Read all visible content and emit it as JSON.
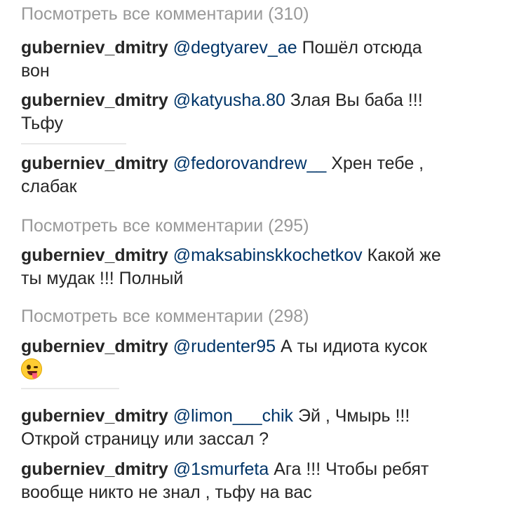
{
  "comments": [
    {
      "type": "view_all",
      "text": "Посмотреть все комментарии (310)"
    },
    {
      "type": "comment",
      "user": "guberniev_dmitry",
      "mention": "@degtyarev_ae",
      "text": "Пошёл отсюда",
      "text2": "вон"
    },
    {
      "type": "comment",
      "user": "guberniev_dmitry",
      "mention": "@katyusha.80",
      "text": "Злая Вы баба !!!",
      "text2": "Тьфу"
    },
    {
      "type": "comment",
      "user": "guberniev_dmitry",
      "mention": "@fedorovandrew__",
      "text": "Хрен тебе ,",
      "text2": "слабак"
    },
    {
      "type": "view_all",
      "text": "Посмотреть все комментарии (295)"
    },
    {
      "type": "comment",
      "user": "guberniev_dmitry",
      "mention": "@maksabinskkochetkov",
      "text": "Какой же",
      "text2": "ты мудак !!! Полный"
    },
    {
      "type": "view_all",
      "text": "Посмотреть все комментарии (298)"
    },
    {
      "type": "comment",
      "user": "guberniev_dmitry",
      "mention": "@rudenter95",
      "text": "А ты идиота кусок",
      "emoji": "zany-face-emoji"
    },
    {
      "type": "comment",
      "user": "guberniev_dmitry",
      "mention": "@limon___chik",
      "text": "Эй , Чмырь !!!",
      "text2": "Открой страницу или зассал ?"
    },
    {
      "type": "comment",
      "user": "guberniev_dmitry",
      "mention": "@1smurfeta",
      "text": "Ага !!! Чтобы ребят",
      "text2": "вообще никто не знал , тьфу на вас"
    }
  ],
  "colors": {
    "text": "#262626",
    "muted": "#999999",
    "mention": "#003569"
  }
}
